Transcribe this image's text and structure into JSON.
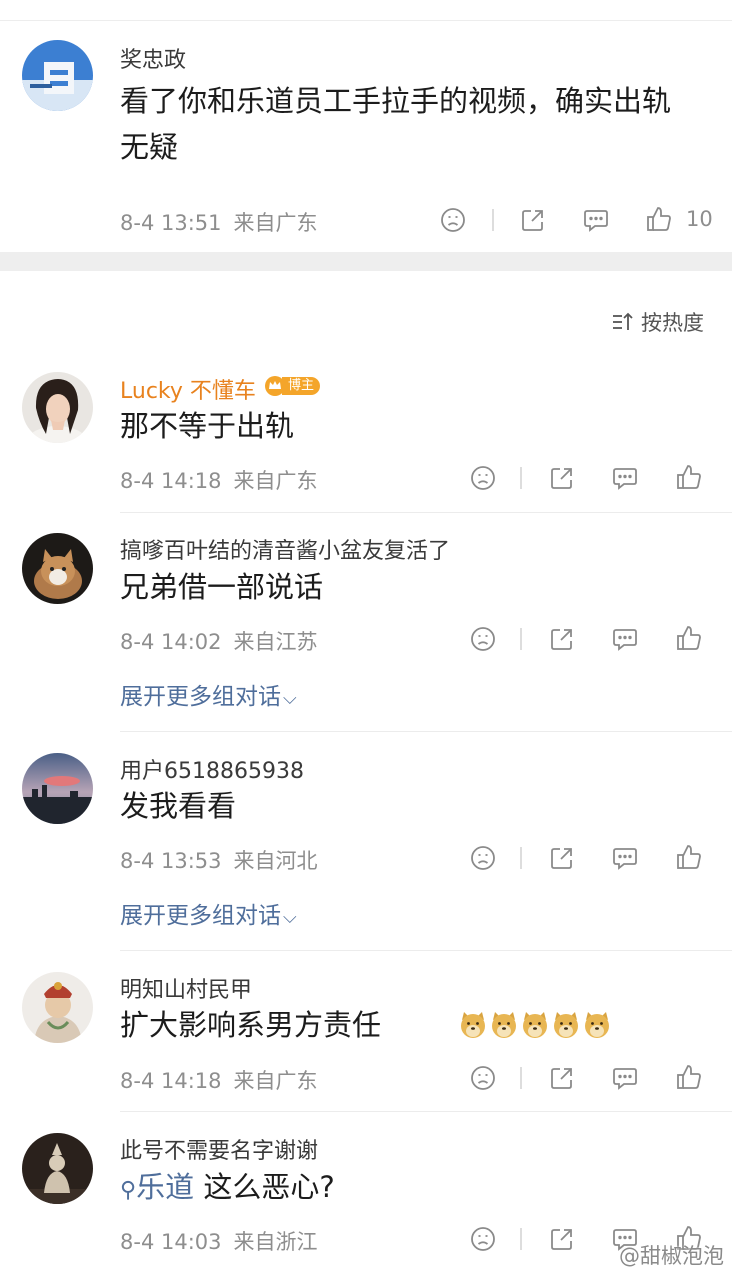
{
  "top_comment": {
    "username": "奖忠政",
    "text_line1": "看了你和乐道员工手拉手的视频，确实出轨",
    "text_line2": "无疑",
    "time": "8-4 13:51",
    "location": "来自广东",
    "likes": "10"
  },
  "sort": {
    "label": "按热度",
    "icon": "sort-icon"
  },
  "replies": [
    {
      "username": "Lucky 不懂车",
      "badge": "博主",
      "text": "那不等于出轨",
      "time": "8-4 14:18",
      "location": "来自广东"
    },
    {
      "username": "搞嗲百叶结的清音酱小盆友复活了",
      "text": "兄弟借一部说话",
      "time": "8-4 14:02",
      "location": "来自江苏",
      "expand": "展开更多组对话"
    },
    {
      "username": "用户6518865938",
      "text": "发我看看",
      "time": "8-4 13:53",
      "location": "来自河北",
      "expand": "展开更多组对话"
    },
    {
      "username": "明知山村民甲",
      "text": "扩大影响系男方责任",
      "emoji_count": 5,
      "time": "8-4 14:18",
      "location": "来自广东"
    },
    {
      "username": "此号不需要名字谢谢",
      "search_term": "乐道",
      "text": " 这么恶心?",
      "time": "8-4 14:03",
      "location": "来自浙江"
    }
  ],
  "watermark": "@甜椒泡泡",
  "colors": {
    "username_orange": "#e8821e",
    "link_blue": "#4f6e9b",
    "meta_gray": "#8e8e8e",
    "badge_gold": "#f4a52a"
  }
}
